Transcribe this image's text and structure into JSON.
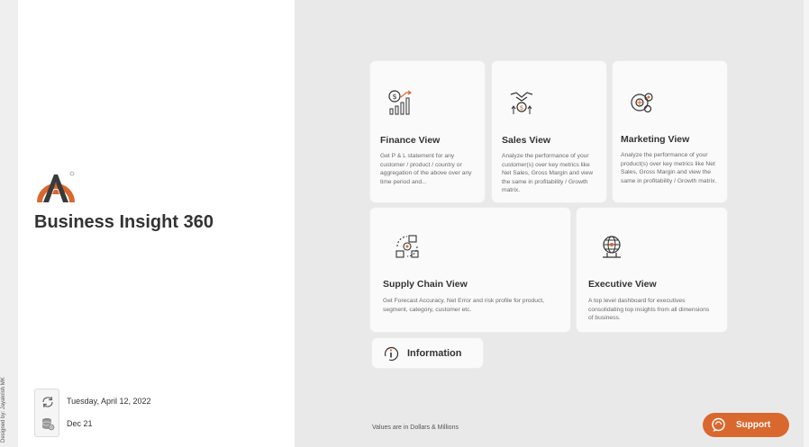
{
  "app": {
    "title": "Business Insight 360",
    "credit": "Designed by: Jayakrish MK",
    "refresh_date": "Tuesday, April 12, 2022",
    "data_period": "Dec 21"
  },
  "colors": {
    "accent": "#d9682f",
    "dark": "#3a3a3a"
  },
  "cards": {
    "finance": {
      "title": "Finance View",
      "description": "Get P & L statement for any customer / product / country or aggregation of the above over any time period and...",
      "icon": "finance-chart-icon"
    },
    "sales": {
      "title": "Sales View",
      "description": "Analyze the performance of your customer(s) over key metrics like Net Sales, Gross Margin and view the same in profitability / Growth matrix.",
      "icon": "handshake-icon"
    },
    "marketing": {
      "title": "Marketing View",
      "description": "Analyze the performance of your product(s) over key metrics like Net Sales, Gross Margin and view the same in profitability / Growth matrix.",
      "icon": "marketing-gears-icon"
    },
    "supply_chain": {
      "title": "Supply Chain View",
      "description": "Get Forecast Accuracy, Net Error and risk profile for product, segment, category, customer etc.",
      "icon": "supply-chain-icon"
    },
    "executive": {
      "title": "Executive View",
      "description": "A top level dashboard for executives consolidating top insights from all dimensions of business.",
      "icon": "executive-globe-icon"
    }
  },
  "information": {
    "label": "Information",
    "icon": "info-icon"
  },
  "footnote": "Values are in Dollars & Millions",
  "support": {
    "label": "Support",
    "icon": "support-chat-icon"
  }
}
